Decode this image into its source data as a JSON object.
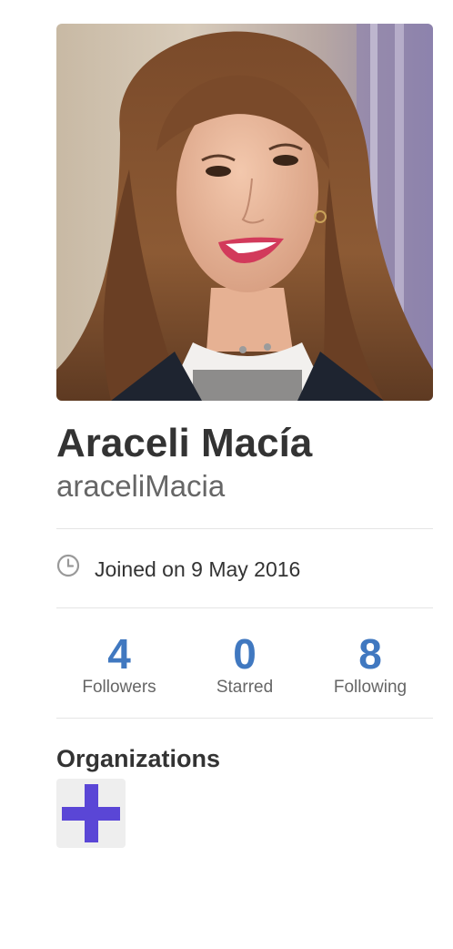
{
  "profile": {
    "fullname": "Araceli Macía",
    "username": "araceliMacia",
    "avatar_alt": "profile photo",
    "joined_label": "Joined on 9 May 2016",
    "joined_icon": "clock-icon"
  },
  "stats": [
    {
      "count": "4",
      "label": "Followers"
    },
    {
      "count": "0",
      "label": "Starred"
    },
    {
      "count": "8",
      "label": "Following"
    }
  ],
  "organizations": {
    "heading": "Organizations",
    "items": [
      {
        "icon": "purple-plus-icon",
        "color": "#5a46d6"
      }
    ]
  },
  "colors": {
    "accent": "#4078c0",
    "text": "#333333",
    "muted": "#666666",
    "divider": "#e5e5e5",
    "org_icon": "#5a46d6"
  }
}
